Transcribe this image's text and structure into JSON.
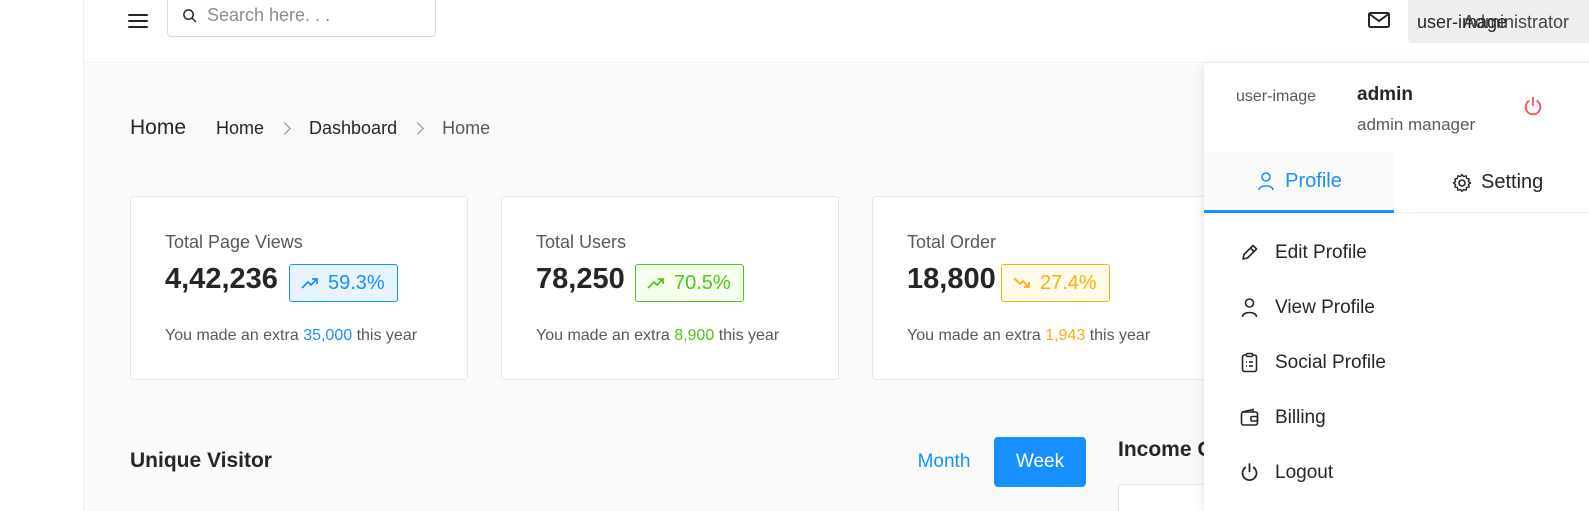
{
  "header": {
    "search_placeholder": "Search here. . .",
    "user_image_alt": "user-image",
    "user_name": "Administrator"
  },
  "breadcrumb": {
    "page_title": "Home",
    "items": [
      "Home",
      "Dashboard",
      "Home"
    ]
  },
  "stats": [
    {
      "label": "Total Page Views",
      "value": "4,42,236",
      "percent": "59.3%",
      "trend": "up",
      "color": "#1890ff",
      "foot_prefix": "You made an extra",
      "foot_value": "35,000",
      "foot_suffix": "this year"
    },
    {
      "label": "Total Users",
      "value": "78,250",
      "percent": "70.5%",
      "trend": "up",
      "color": "#52c41a",
      "foot_prefix": "You made an extra",
      "foot_value": "8,900",
      "foot_suffix": "this year"
    },
    {
      "label": "Total Order",
      "value": "18,800",
      "percent": "27.4%",
      "trend": "down",
      "color": "#faad14",
      "foot_prefix": "You made an extra",
      "foot_value": "1,943",
      "foot_suffix": "this year"
    }
  ],
  "visitor": {
    "title": "Unique Visitor",
    "month_label": "Month",
    "week_label": "Week",
    "selected": "Week"
  },
  "income": {
    "title": "Income Overview"
  },
  "profile_dropdown": {
    "avatar_alt": "user-image",
    "name": "admin",
    "role": "admin manager",
    "tabs": [
      {
        "label": "Profile",
        "icon": "user-icon",
        "active": true
      },
      {
        "label": "Setting",
        "icon": "gear-icon",
        "active": false
      }
    ],
    "menu": [
      {
        "label": "Edit Profile",
        "icon": "edit-icon"
      },
      {
        "label": "View Profile",
        "icon": "user-icon"
      },
      {
        "label": "Social Profile",
        "icon": "clipboard-icon"
      },
      {
        "label": "Billing",
        "icon": "wallet-icon"
      },
      {
        "label": "Logout",
        "icon": "power-icon"
      }
    ]
  },
  "colors": {
    "primary": "#1890ff",
    "success": "#52c41a",
    "warning": "#faad14",
    "danger": "#ff4d4f"
  }
}
